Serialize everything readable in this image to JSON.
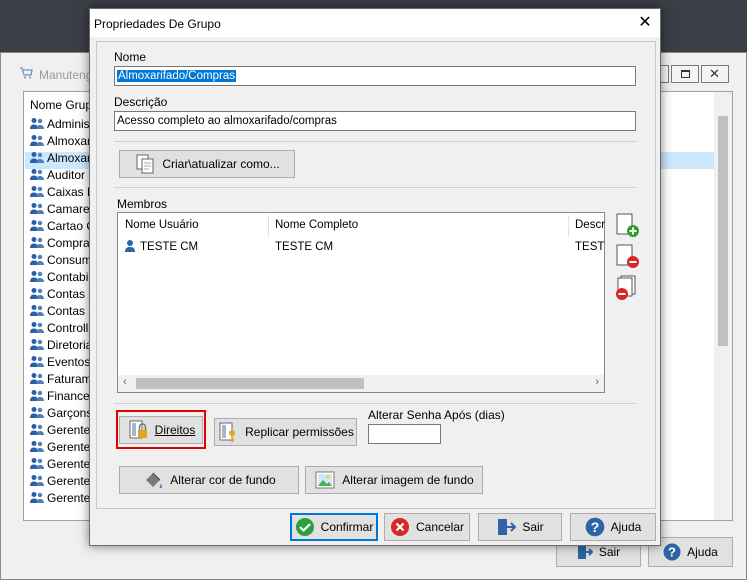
{
  "background_window": {
    "title": "Manuteng",
    "header": "Nome Grupo",
    "rows": [
      "Administ",
      "Almoxarif",
      "Almoxarif",
      "Auditor I",
      "Caixas PD",
      "Camareir",
      "Cartao C",
      "Compras",
      "Consumo",
      "Contabil",
      "Contas a",
      "Contas a",
      "Controlle",
      "Diretoria",
      "Eventos",
      "Faturame",
      "Financeir",
      "Garçons",
      "Gerente",
      "Gerente",
      "Gerente",
      "Gerente",
      "Gerente"
    ],
    "footer": {
      "exit_label": "Sair",
      "help_label": "Ajuda"
    }
  },
  "dialog": {
    "title": "Propriedades De Grupo",
    "name_label": "Nome",
    "name_value": "Almoxarifado/Compras",
    "description_label": "Descrição",
    "description_value": "Acesso completo ao almoxarifado/compras",
    "create_update_label": "Criar\\atualizar como...",
    "members_label": "Membros",
    "members_table": {
      "columns": [
        "Nome Usuário",
        "Nome Completo",
        "Descr"
      ],
      "rows": [
        {
          "user": "TESTE CM",
          "full_name": "TESTE CM",
          "desc": "TESTE"
        }
      ]
    },
    "rights_label": "Direitos",
    "replicate_label": "Replicar permissões",
    "change_password_label": "Alterar Senha Após (dias)",
    "change_password_value": "",
    "bg_color_label": "Alterar cor de fundo",
    "bg_image_label": "Alterar imagem de fundo",
    "footer": {
      "confirm_label": "Confirmar",
      "cancel_label": "Cancelar",
      "exit_label": "Sair",
      "help_label": "Ajuda"
    }
  }
}
